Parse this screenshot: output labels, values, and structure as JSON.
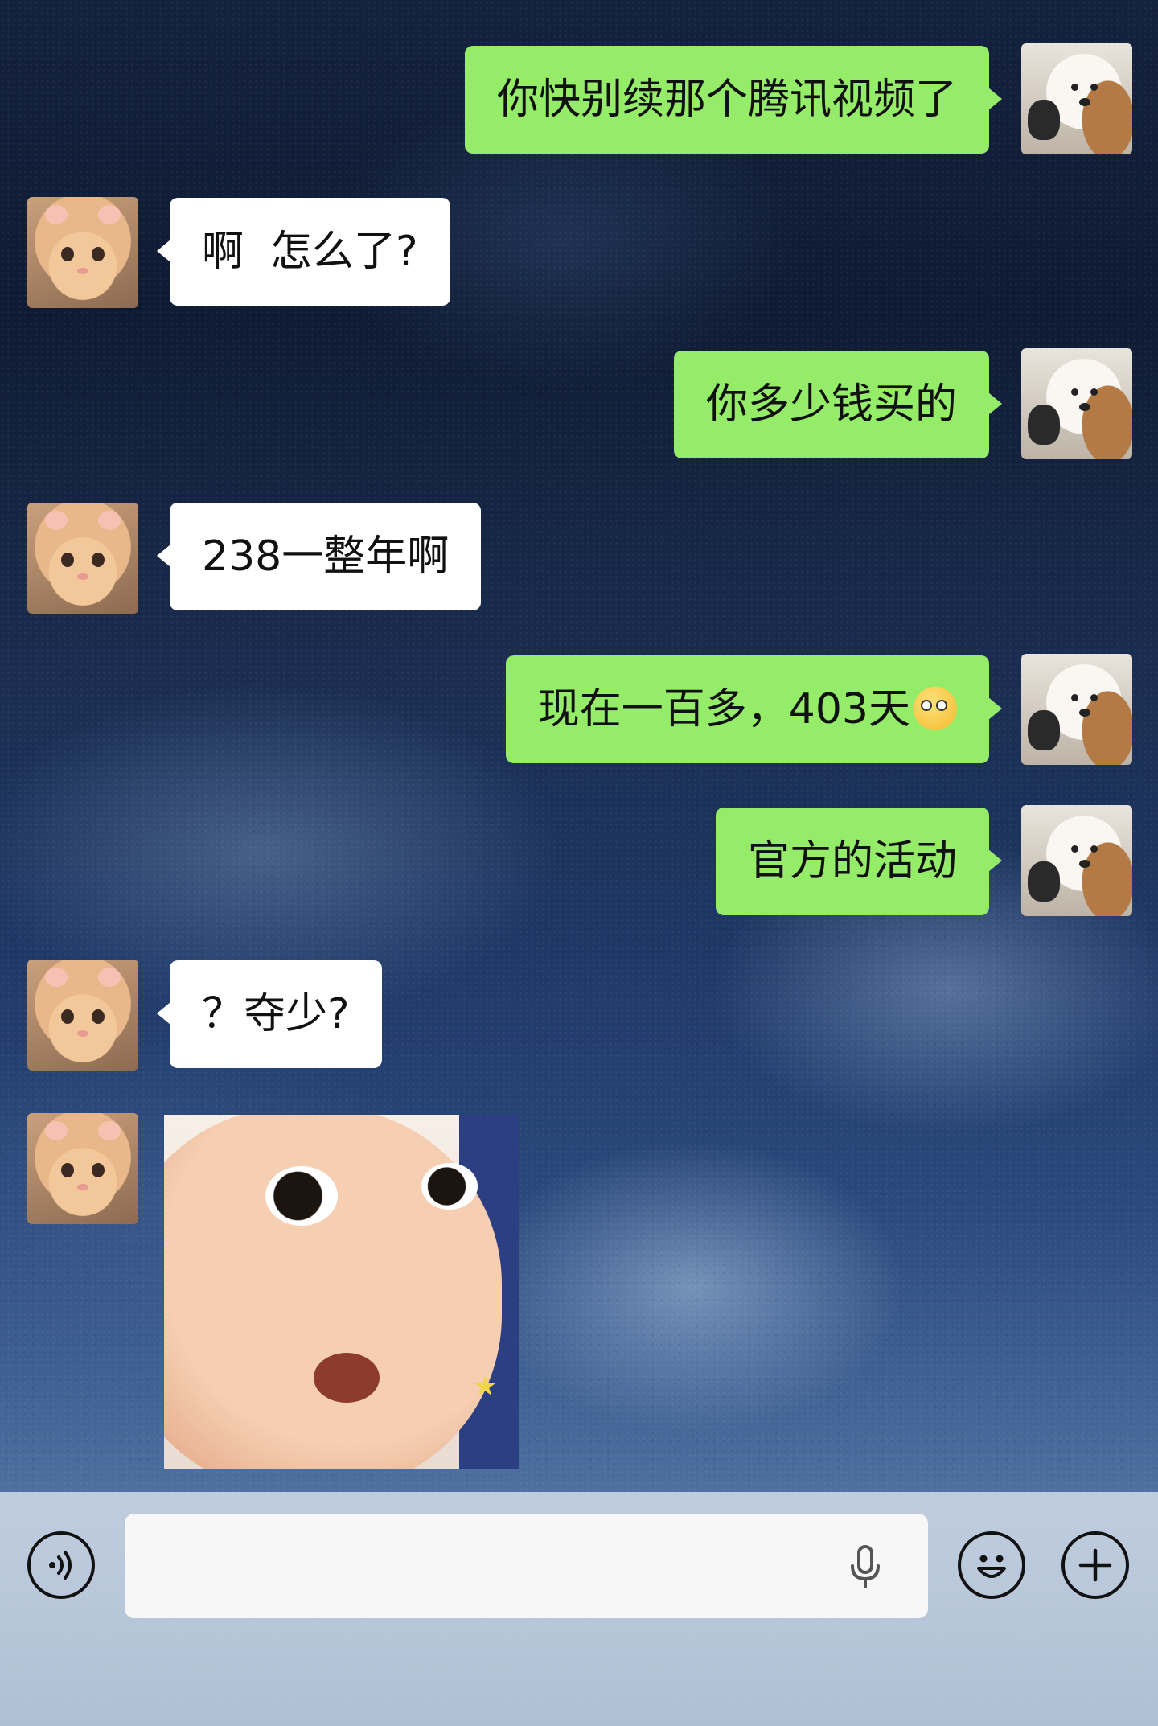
{
  "messages": [
    {
      "side": "out",
      "text": "你快别续那个腾讯视频了"
    },
    {
      "side": "in",
      "text": "啊  怎么了?"
    },
    {
      "side": "out",
      "text": "你多少钱买的"
    },
    {
      "side": "in",
      "text": "238一整年啊"
    },
    {
      "side": "out",
      "text": "现在一百多，403天"
    },
    {
      "side": "out",
      "text": "官方的活动"
    },
    {
      "side": "in",
      "text": "？夺少?"
    },
    {
      "side": "in",
      "type": "sticker",
      "sticker": "surprised-baby-sticker"
    }
  ],
  "input_bar": {
    "text_value": "",
    "voice_icon": "voice-wave-icon",
    "mic_icon": "microphone-icon",
    "emoji_icon": "smiley-icon",
    "plus_icon": "plus-icon"
  },
  "colors": {
    "outgoing_bubble": "#95ec69",
    "incoming_bubble": "#ffffff",
    "input_field": "#f7f7f7"
  }
}
